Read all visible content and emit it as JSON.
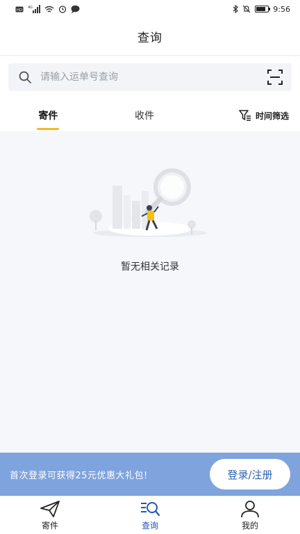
{
  "status_bar": {
    "time": "9:56",
    "network": "4G",
    "icons": [
      "hd-icon",
      "signal-icon",
      "wifi-icon",
      "alarm-icon",
      "message-icon",
      "bluetooth-icon",
      "mute-icon",
      "battery-icon"
    ],
    "battery_level": 0.8
  },
  "header": {
    "title": "查询"
  },
  "search": {
    "placeholder": "请输入运单号查询",
    "value": ""
  },
  "tabs": [
    {
      "label": "寄件",
      "active": true
    },
    {
      "label": "收件",
      "active": false
    }
  ],
  "filter": {
    "label": "时间筛选"
  },
  "empty_state": {
    "message": "暂无相关记录"
  },
  "promo": {
    "text": "首次登录可获得25元优惠大礼包!",
    "button_label": "登录/注册"
  },
  "bottom_nav": [
    {
      "label": "寄件",
      "icon": "paper-plane-icon",
      "active": false
    },
    {
      "label": "查询",
      "icon": "search-list-icon",
      "active": true
    },
    {
      "label": "我的",
      "icon": "user-icon",
      "active": false
    }
  ],
  "colors": {
    "accent_tab": "#f5b826",
    "promo_bg": "#7fa3dc",
    "brand_blue": "#1f56b8",
    "page_bg": "#f5f7fb"
  }
}
